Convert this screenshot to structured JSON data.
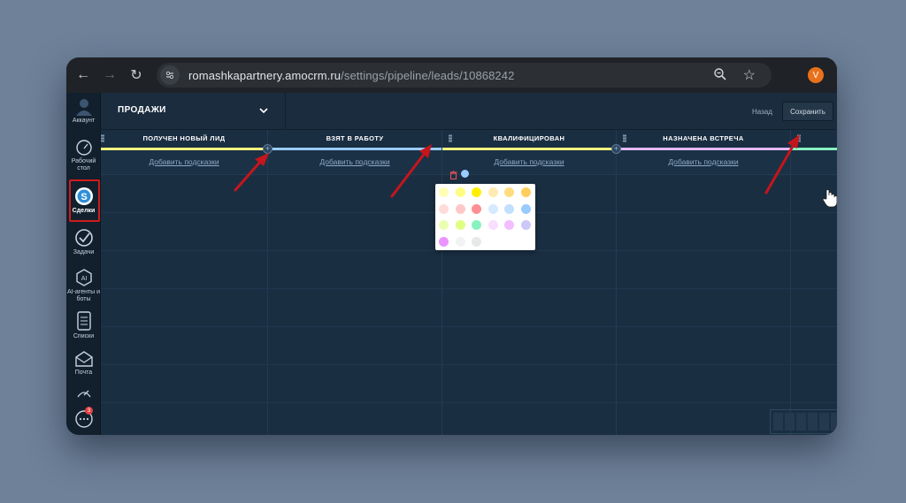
{
  "browser": {
    "url_host": "romashkapartnery.amocrm.ru",
    "url_path": "/settings/pipeline/leads/10868242",
    "profile_initial": "V"
  },
  "sidebar": {
    "items": [
      {
        "label": "Аккаунт",
        "icon": "user-icon"
      },
      {
        "label": "Рабочий стол",
        "icon": "dashboard-icon"
      },
      {
        "label": "Сделки",
        "icon": "deals-icon",
        "active": true
      },
      {
        "label": "Задачи",
        "icon": "check-icon"
      },
      {
        "label": "AI-агенты и боты",
        "icon": "ai-icon"
      },
      {
        "label": "Списки",
        "icon": "list-icon"
      },
      {
        "label": "Почта",
        "icon": "mail-icon"
      },
      {
        "label": "",
        "icon": "stats-icon"
      },
      {
        "label": "",
        "icon": "chat-icon",
        "badge": "3"
      }
    ]
  },
  "topbar": {
    "pipeline_name": "ПРОДАЖИ",
    "back_label": "Назад",
    "save_label": "Сохранить"
  },
  "columns": [
    {
      "title": "ПОЛУЧЕН НОВЫЙ ЛИД",
      "link": "Добавить подсказки",
      "color": "#fffd7f"
    },
    {
      "title": "ВЗЯТ В РАБОТУ",
      "link": "Добавить подсказки",
      "color": "#99ccff"
    },
    {
      "title": "КВАЛИФИЦИРОВАН",
      "link": "Добавить подсказки",
      "color": "#fffd7f"
    },
    {
      "title": "НАЗНАЧЕНА ВСТРЕЧА",
      "link": "Добавить подсказки",
      "color": "#e6b8ff"
    },
    {
      "title": "",
      "link": "",
      "color": "#87f2c0"
    }
  ],
  "palette_colors": [
    "#fffeb2",
    "#fffd7f",
    "#fff000",
    "#ffeab2",
    "#ffdc7f",
    "#ffce5a",
    "#ffdbdb",
    "#ffc8c8",
    "#ff8f92",
    "#d6eaff",
    "#c1e0ff",
    "#98cbff",
    "#ebffb1",
    "#deff81",
    "#87f2c0",
    "#f9deff",
    "#f3beff",
    "#ccc8f9",
    "#eb93ff",
    "#f2f3f4",
    "#e6e8ea"
  ]
}
